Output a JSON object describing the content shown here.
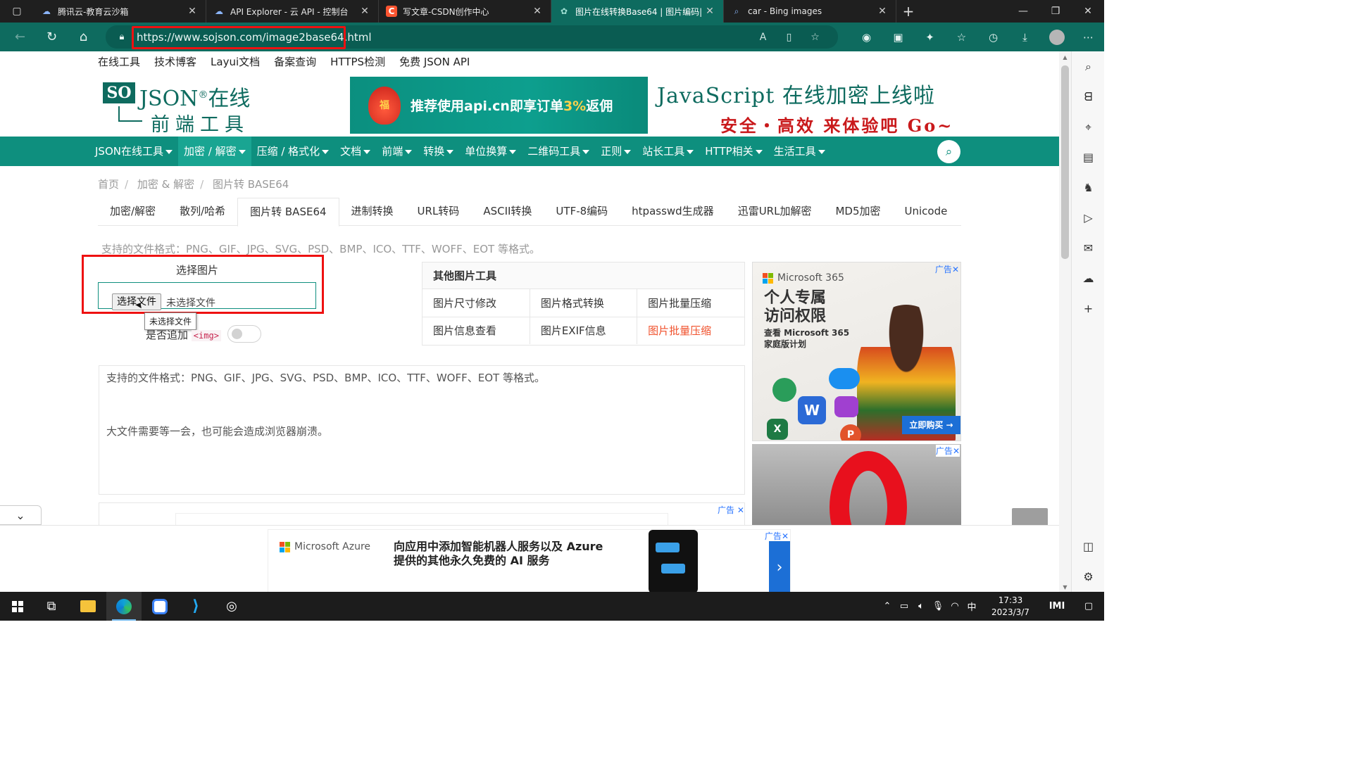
{
  "browser": {
    "tabs": [
      {
        "title": "腾讯云-教育云沙箱",
        "icon": "cloud-icon",
        "active": false
      },
      {
        "title": "API Explorer - 云 API - 控制台",
        "icon": "cloud-icon",
        "active": false
      },
      {
        "title": "写文章-CSDN创作中心",
        "icon": "csdn-icon",
        "active": false
      },
      {
        "title": "图片在线转换Base64 | 图片编码|",
        "icon": "gear-icon",
        "active": true
      },
      {
        "title": "car - Bing images",
        "icon": "search-icon",
        "active": false
      }
    ],
    "url": "https://www.sojson.com/image2base64.html"
  },
  "site": {
    "top_links": [
      "在线工具",
      "技术博客",
      "Layui文档",
      "备案查询",
      "HTTPS检测",
      "免费 JSON API"
    ],
    "logo": {
      "mark": "SO",
      "name": "JSON",
      "reg": "®",
      "cn": "在线",
      "sub": "前端工具"
    },
    "banner_left": {
      "text_a": "推荐使用api.cn即享订单",
      "highlight": "3%",
      "text_b": "返佣",
      "bag": "福"
    },
    "banner_right": {
      "line1": "JavaScript 在线加密上线啦",
      "line2": "安全・高效 来体验吧 Go~"
    },
    "nav": [
      "JSON在线工具",
      "加密 / 解密",
      "压缩 / 格式化",
      "文档",
      "前端",
      "转换",
      "单位换算",
      "二维码工具",
      "正则",
      "站长工具",
      "HTTP相关",
      "生活工具"
    ],
    "nav_active": 1
  },
  "breadcrumb": [
    "首页",
    "加密 & 解密",
    "图片转 BASE64"
  ],
  "subtabs": [
    "加密/解密",
    "散列/哈希",
    "图片转 BASE64",
    "进制转换",
    "URL转码",
    "ASCII转换",
    "UTF-8编码",
    "htpasswd生成器",
    "迅雷URL加解密",
    "MD5加密",
    "Unicode"
  ],
  "subtab_active": 2,
  "main": {
    "formats": "支持的文件格式：PNG、GIF、JPG、SVG、PSD、BMP、ICO、TTF、WOFF、EOT 等格式。",
    "choose_label": "选择图片",
    "file_button": "选择文件",
    "file_none": "未选择文件",
    "tooltip": "未选择文件",
    "append_label": "是否追加",
    "append_code": "<img>",
    "append_enabled": false,
    "output_line1": "支持的文件格式：PNG、GIF、JPG、SVG、PSD、BMP、ICO、TTF、WOFF、EOT 等格式。",
    "output_line2": "大文件需要等一会，也可能会造成浏览器崩溃。"
  },
  "other_tools": {
    "title": "其他图片工具",
    "rows": [
      [
        "图片尺寸修改",
        "图片格式转换",
        "图片批量压缩"
      ],
      [
        "图片信息查看",
        "图片EXIF信息",
        "图片批量压缩"
      ]
    ]
  },
  "ads": {
    "tag": "广告",
    "ms365": {
      "brand": "Microsoft 365",
      "headline1": "个人专属",
      "headline2": "访问权限",
      "sub1": "查看 Microsoft 365",
      "sub2": "家庭版计划",
      "cta": "立即购买 →"
    },
    "azure": {
      "brand": "Microsoft Azure",
      "line1": "向应用中添加智能机器人服务以及 Azure",
      "line2": "提供的其他永久免费的 AI 服务",
      "next": "›"
    }
  },
  "taskbar": {
    "time": "17:33",
    "date": "2023/3/7",
    "ime": "中"
  },
  "colors": {
    "brand": "#0e8f7e",
    "chrome": "#0e6b5f",
    "highlight": "#ee1111",
    "link_red": "#f0512c"
  }
}
